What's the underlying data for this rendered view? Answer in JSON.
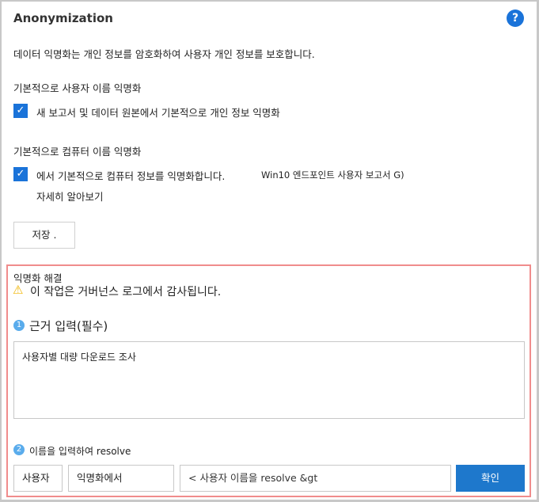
{
  "title": "Anonymization",
  "help_icon": "?",
  "description": "데이터 익명화는 개인 정보를 암호화하여 사용자 개인 정보를 보호합니다.",
  "user_section": {
    "heading": "기본적으로 사용자 이름 익명화",
    "checkbox_label": "새 보고서 및 데이터 원본에서 기본적으로 개인 정보 익명화",
    "checked": true
  },
  "computer_section": {
    "heading": "기본적으로 컴퓨터 이름 익명화",
    "checkbox_label": "에서 기본적으로 컴퓨터 정보를 익명화합니다.",
    "extra": "Win10 엔드포인트 사용자 보고서 G)",
    "learn_more": "자세히 알아보기",
    "checked": true
  },
  "save_label": "저장 .",
  "resolve": {
    "heading": "익명화 해결",
    "warning": "이 작업은 거버넌스 로그에서 감사됩니다.",
    "step1_num": "1",
    "step1_label": "근거 입력(필수)",
    "reason_value": "사용자별 대량 다운로드 조사",
    "step2_num": "2",
    "step2_label": "이름을 입력하여 resolve",
    "type_value": "사용자",
    "source_value": "익명화에서",
    "name_placeholder": "< 사용자 이름을 resolve &gt",
    "confirm_label": "확인"
  },
  "colors": {
    "accent": "#1a73d9",
    "panel_border": "#f08c8c"
  }
}
